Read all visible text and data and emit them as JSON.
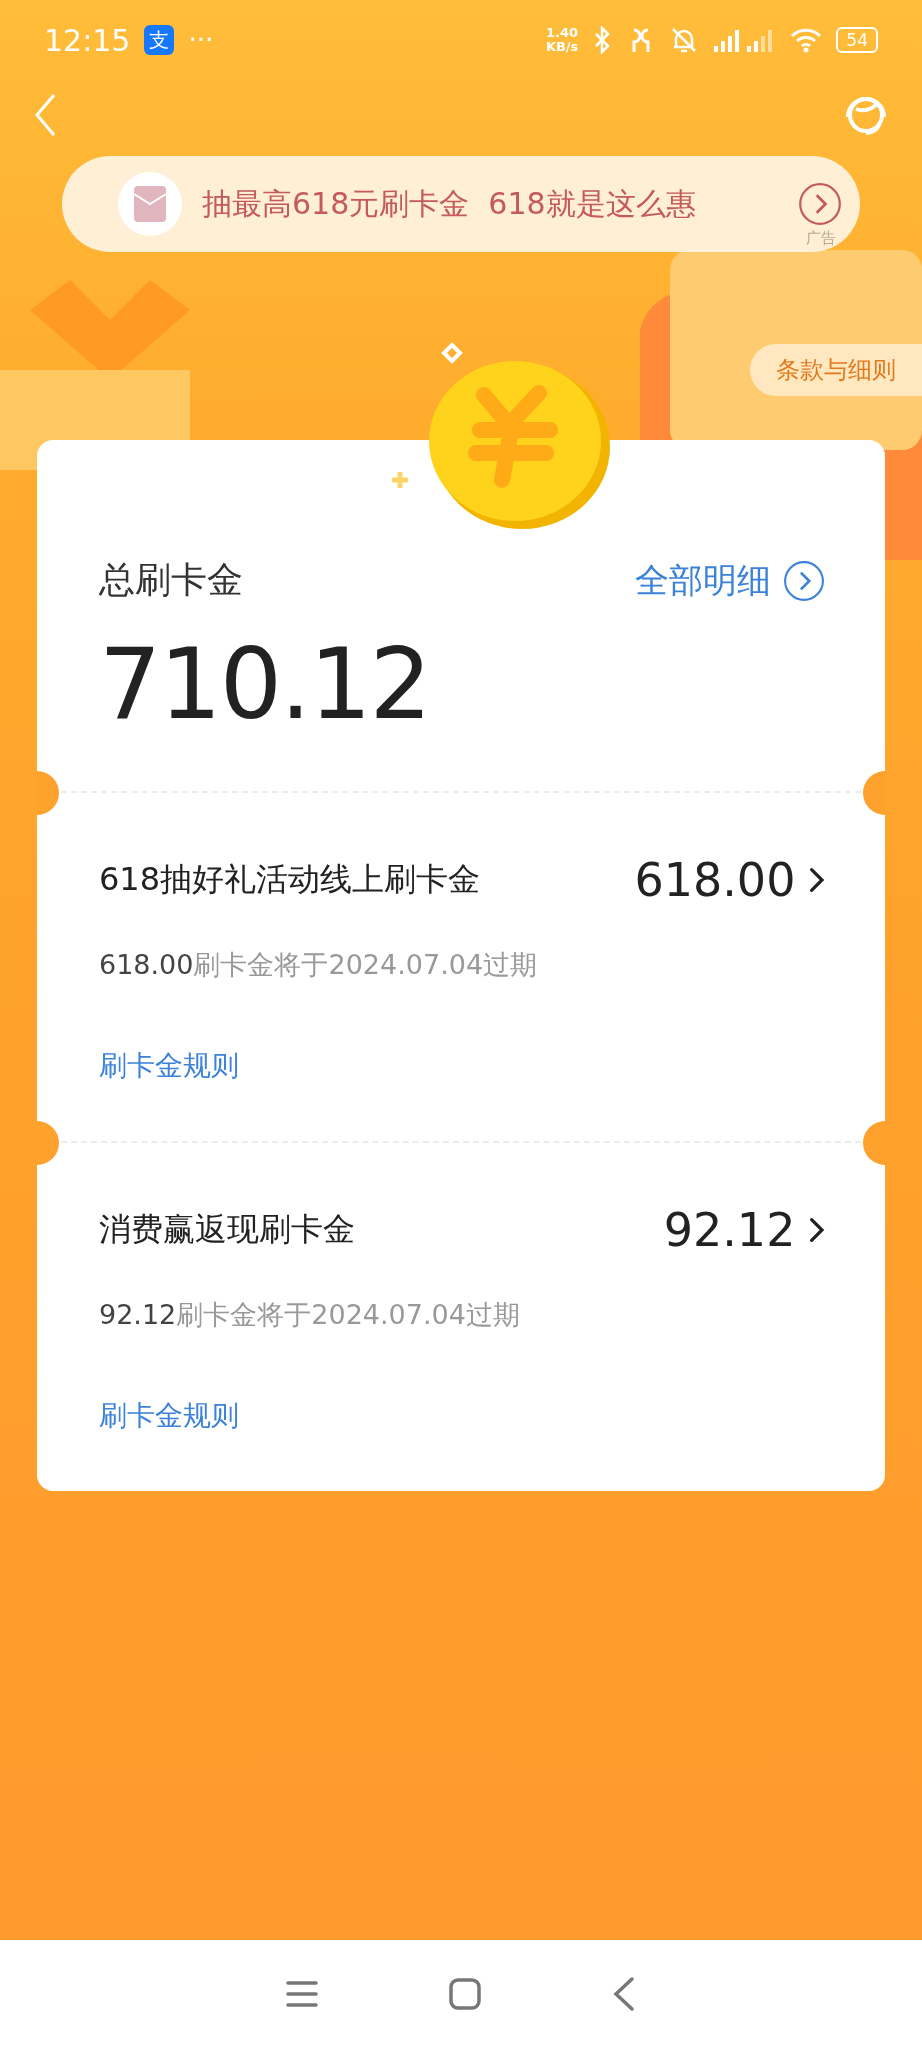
{
  "status_bar": {
    "time": "12:15",
    "app_badge": "支",
    "more": "···",
    "speed_value": "1.40",
    "speed_unit": "KB/s",
    "battery": "54"
  },
  "banner": {
    "text": "抽最高618元刷卡金  618就是这么惠",
    "ad_label": "广告"
  },
  "terms_button": "条款与细则",
  "summary": {
    "label": "总刷卡金",
    "amount": "710.12",
    "details_link": "全部明细"
  },
  "items": [
    {
      "title": "618抽好礼活动线上刷卡金",
      "amount": "618.00",
      "expiry": "**618.00**刷卡金将于2024.07.04过期",
      "rules_link": "刷卡金规则"
    },
    {
      "title": "消费赢返现刷卡金",
      "amount": "92.12",
      "expiry": "**92.12**刷卡金将于2024.07.04过期",
      "rules_link": "刷卡金规则"
    }
  ]
}
